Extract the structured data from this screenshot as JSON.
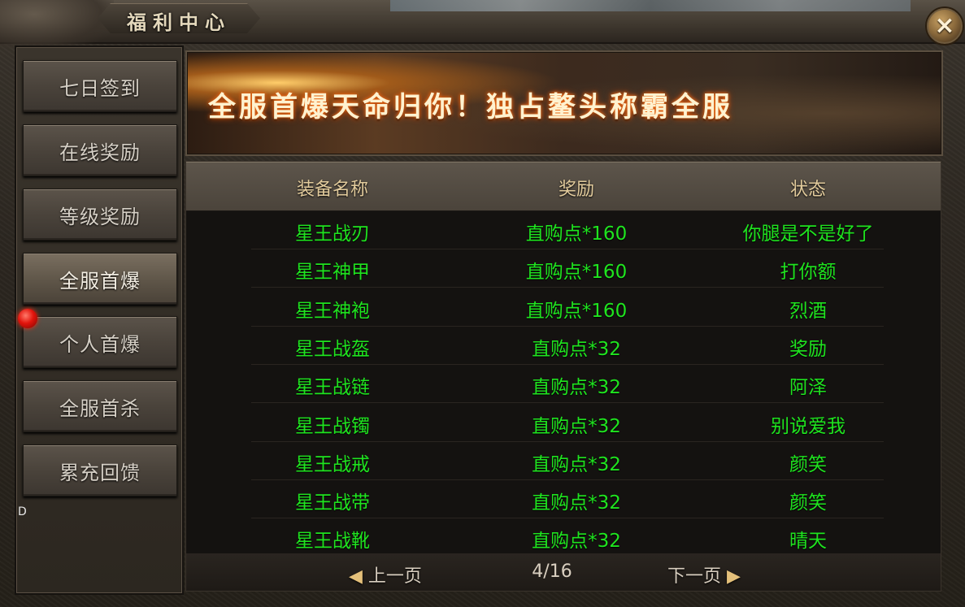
{
  "window": {
    "title": "福利中心",
    "close_icon": "×"
  },
  "sidebar": {
    "items": [
      {
        "label": "七日签到",
        "active": false
      },
      {
        "label": "在线奖励",
        "active": false
      },
      {
        "label": "等级奖励",
        "active": false
      },
      {
        "label": "全服首爆",
        "active": true
      },
      {
        "label": "个人首爆",
        "active": false
      },
      {
        "label": "全服首杀",
        "active": false
      },
      {
        "label": "累充回馈",
        "active": false
      }
    ],
    "stray_text": "D"
  },
  "banner": {
    "text": "全服首爆天命归你！独占鳌头称霸全服"
  },
  "table": {
    "headers": [
      "装备名称",
      "奖励",
      "状态"
    ],
    "rows": [
      {
        "name": "星王战刃",
        "reward": "直购点*160",
        "status": "你腿是不是好了"
      },
      {
        "name": "星王神甲",
        "reward": "直购点*160",
        "status": "打你额"
      },
      {
        "name": "星王神袍",
        "reward": "直购点*160",
        "status": "烈酒"
      },
      {
        "name": "星王战盔",
        "reward": "直购点*32",
        "status": "奖励"
      },
      {
        "name": "星王战链",
        "reward": "直购点*32",
        "status": "阿泽"
      },
      {
        "name": "星王战镯",
        "reward": "直购点*32",
        "status": "别说爱我"
      },
      {
        "name": "星王战戒",
        "reward": "直购点*32",
        "status": "颜笑"
      },
      {
        "name": "星王战带",
        "reward": "直购点*32",
        "status": "颜笑"
      },
      {
        "name": "星王战靴",
        "reward": "直购点*32",
        "status": "晴天"
      }
    ]
  },
  "pager": {
    "prev_label": "上一页",
    "next_label": "下一页",
    "page": "4/16",
    "prev_icon": "◀",
    "next_icon": "▶"
  },
  "colors": {
    "row_text": "#1fe41f",
    "header_text": "#e2cb9c"
  }
}
